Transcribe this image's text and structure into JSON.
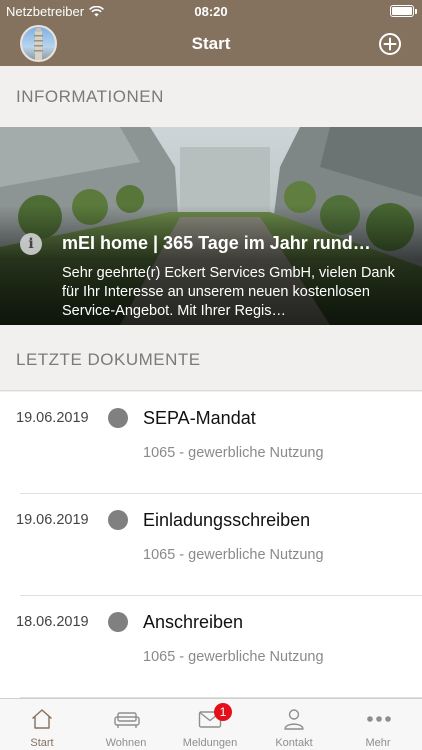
{
  "status_bar": {
    "carrier": "Netzbetreiber",
    "time": "08:20",
    "battery_percent": 100
  },
  "nav": {
    "title": "Start"
  },
  "sections": {
    "info": "INFORMATIONEN",
    "docs": "LETZTE DOKUMENTE"
  },
  "news": {
    "title": "mEI home | 365 Tage im Jahr rund…",
    "excerpt": "Sehr geehrte(r) Eckert Services GmbH, vielen Dank für Ihr Interesse an unserem neuen kostenlosen Service-Angebot. Mit Ihrer Regis…"
  },
  "documents": [
    {
      "date": "19.06.2019",
      "name": "SEPA-Mandat",
      "subtitle": "1065 - gewerbliche Nutzung"
    },
    {
      "date": "19.06.2019",
      "name": "Einladungsschreiben",
      "subtitle": "1065 - gewerbliche Nutzung"
    },
    {
      "date": "18.06.2019",
      "name": "Anschreiben",
      "subtitle": "1065 - gewerbliche Nutzung"
    }
  ],
  "tabs": [
    {
      "label": "Start",
      "icon": "house-icon",
      "active": true
    },
    {
      "label": "Wohnen",
      "icon": "sofa-icon"
    },
    {
      "label": "Meldungen",
      "icon": "envelope-icon",
      "badge": "1"
    },
    {
      "label": "Kontakt",
      "icon": "person-icon"
    },
    {
      "label": "Mehr",
      "icon": "more-dots-icon"
    }
  ],
  "colors": {
    "brand": "#84715e",
    "badge": "#e3101b",
    "dot": "#808080"
  }
}
